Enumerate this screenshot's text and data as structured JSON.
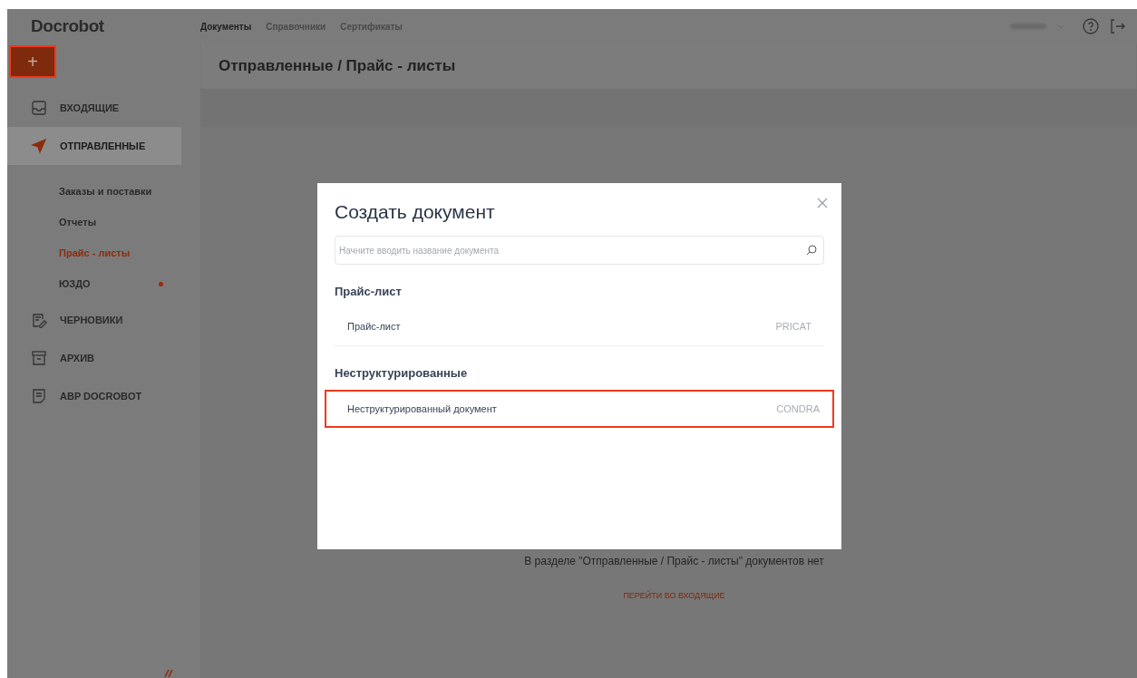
{
  "top_bar": {
    "logo": "Docrobot",
    "nav": [
      {
        "label": "Документы",
        "selected": true
      },
      {
        "label": "Справочники",
        "selected": false
      },
      {
        "label": "Сертификаты",
        "selected": false
      }
    ]
  },
  "create_button": {
    "label": "+",
    "highlighted": true
  },
  "sidebar": {
    "items": [
      {
        "label": "ВХОДЯЩИЕ",
        "selected": false
      },
      {
        "label": "ОТПРАВЛЕННЫЕ",
        "selected": true,
        "children": [
          {
            "label": "Заказы и поставки",
            "selected": false,
            "notification": false
          },
          {
            "label": "Отчеты",
            "selected": false,
            "notification": false
          },
          {
            "label": "Прайс - листы",
            "selected": true,
            "notification": false
          },
          {
            "label": "ЮЗДО",
            "selected": false,
            "notification": true
          }
        ]
      },
      {
        "label": "ЧЕРНОВИКИ",
        "selected": false
      },
      {
        "label": "АРХИВ",
        "selected": false
      },
      {
        "label": "ABP DOCROBOT",
        "selected": false
      }
    ]
  },
  "page": {
    "title": "Отправленные / Прайс - листы",
    "empty_message": "В разделе \"Отправленные / Прайс - листы\" документов нет",
    "empty_link": "ПЕРЕЙТИ ВО ВХОДЯЩИЕ"
  },
  "modal": {
    "title": "Создать документ",
    "search": {
      "placeholder": "Начните вводить название документа"
    },
    "groups": [
      {
        "title": "Прайс-лист",
        "items": [
          {
            "label": "Прайс-лист",
            "code": "PRICAT",
            "highlighted": false
          }
        ]
      },
      {
        "title": "Неструктурированные",
        "items": [
          {
            "label": "Неструктурированный документ",
            "code": "CONDRA",
            "highlighted": true
          }
        ]
      }
    ]
  }
}
